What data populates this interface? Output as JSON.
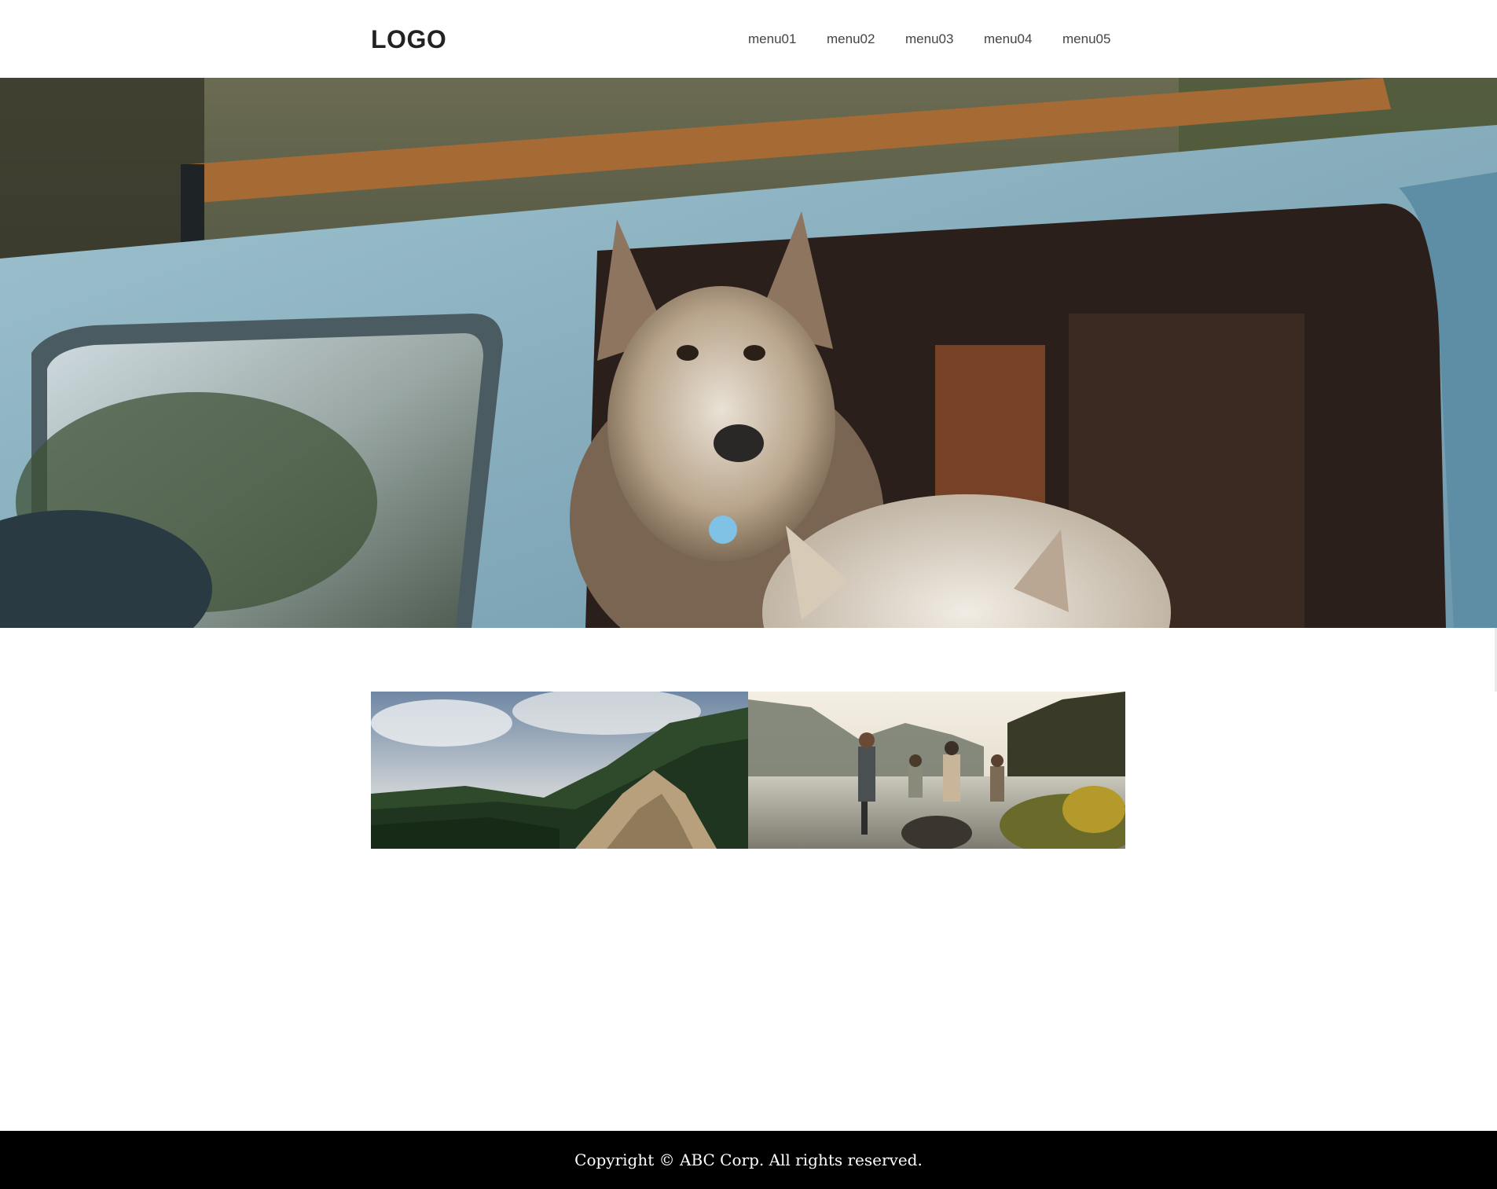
{
  "header": {
    "logo": "LOGO",
    "menu": [
      {
        "label": "menu01"
      },
      {
        "label": "menu02"
      },
      {
        "label": "menu03"
      },
      {
        "label": "menu04"
      },
      {
        "label": "menu05"
      }
    ]
  },
  "hero": {
    "image": "huskies-in-vintage-van-photo"
  },
  "gallery": {
    "items": [
      {
        "image": "forest-cliff-photo"
      },
      {
        "image": "people-wading-in-lake-photo"
      }
    ]
  },
  "footer": {
    "copyright": "Copyright © ABC Corp. All rights reserved."
  },
  "colors": {
    "footer_bg": "#000000",
    "footer_text": "#ffffff",
    "logo_text": "#222222",
    "nav_text": "#444444"
  }
}
